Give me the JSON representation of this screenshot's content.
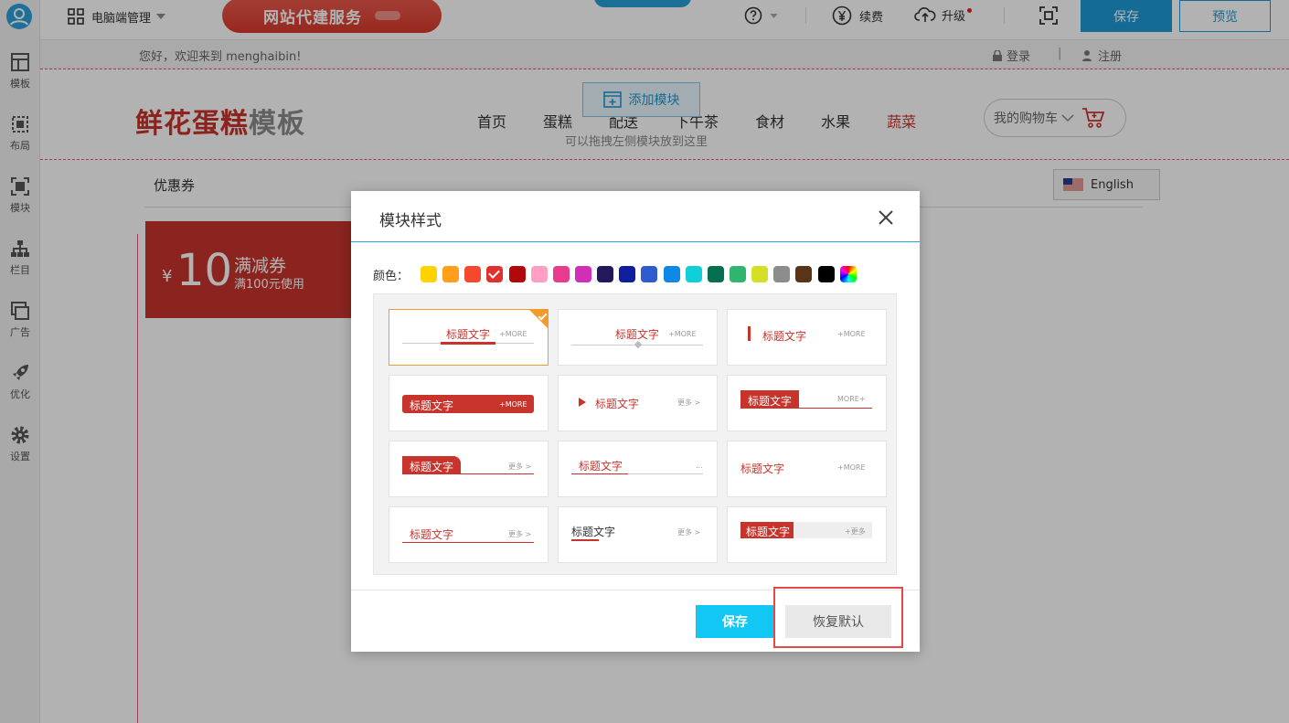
{
  "toolbar": {
    "manager_label": "电脑端管理",
    "banner_text": "网站代建服务",
    "renew_label": "续费",
    "upgrade_label": "升级",
    "save_label": "保存",
    "preview_label": "预览"
  },
  "sidebar": {
    "items": [
      {
        "label": "模板",
        "icon": "template-icon"
      },
      {
        "label": "布局",
        "icon": "layout-icon"
      },
      {
        "label": "模块",
        "icon": "module-icon"
      },
      {
        "label": "栏目",
        "icon": "sitemap-icon"
      },
      {
        "label": "广告",
        "icon": "ad-icon"
      },
      {
        "label": "优化",
        "icon": "rocket-icon"
      },
      {
        "label": "设置",
        "icon": "gear-icon"
      }
    ]
  },
  "site": {
    "welcome": "您好，欢迎来到 menghaibin!",
    "login": "登录",
    "separator": "|",
    "register": "注册",
    "logo_red": "鲜花蛋糕",
    "logo_gray": "模板",
    "add_module": "添加模块",
    "drag_hint": "可以拖拽左侧模块放到这里",
    "nav": [
      "首页",
      "蛋糕",
      "配送",
      "下午茶",
      "食材",
      "水果",
      "蔬菜"
    ],
    "nav_active_index": 6,
    "cart": "我的购物车",
    "coupon_section": "优惠券",
    "language": "English",
    "coupon": {
      "currency": "¥",
      "amount": "10",
      "name": "满减券",
      "desc": "满100元使用"
    }
  },
  "modal": {
    "title": "模块样式",
    "color_label": "颜色：",
    "colors": [
      "#ffd200",
      "#ff9f1c",
      "#f5482c",
      "#e2302d",
      "#b0080b",
      "#ff9fc3",
      "#e83a8f",
      "#d12fb4",
      "#22195d",
      "#0e1e9c",
      "#2f5bd1",
      "#0e8ae6",
      "#0fcfd9",
      "#046e51",
      "#2fb56e",
      "#d5df26",
      "#8c8c8c",
      "#5a3416",
      "#000000"
    ],
    "selected_color_index": 3,
    "selected_style_index": 0,
    "styles": {
      "title": "标题文字",
      "more_plus": "+MORE",
      "more_cn": "更多 >",
      "more_dots": "...",
      "more_text": "MORE+",
      "more_plus_cn": "+更多"
    },
    "save_label": "保存",
    "reset_label": "恢复默认"
  }
}
